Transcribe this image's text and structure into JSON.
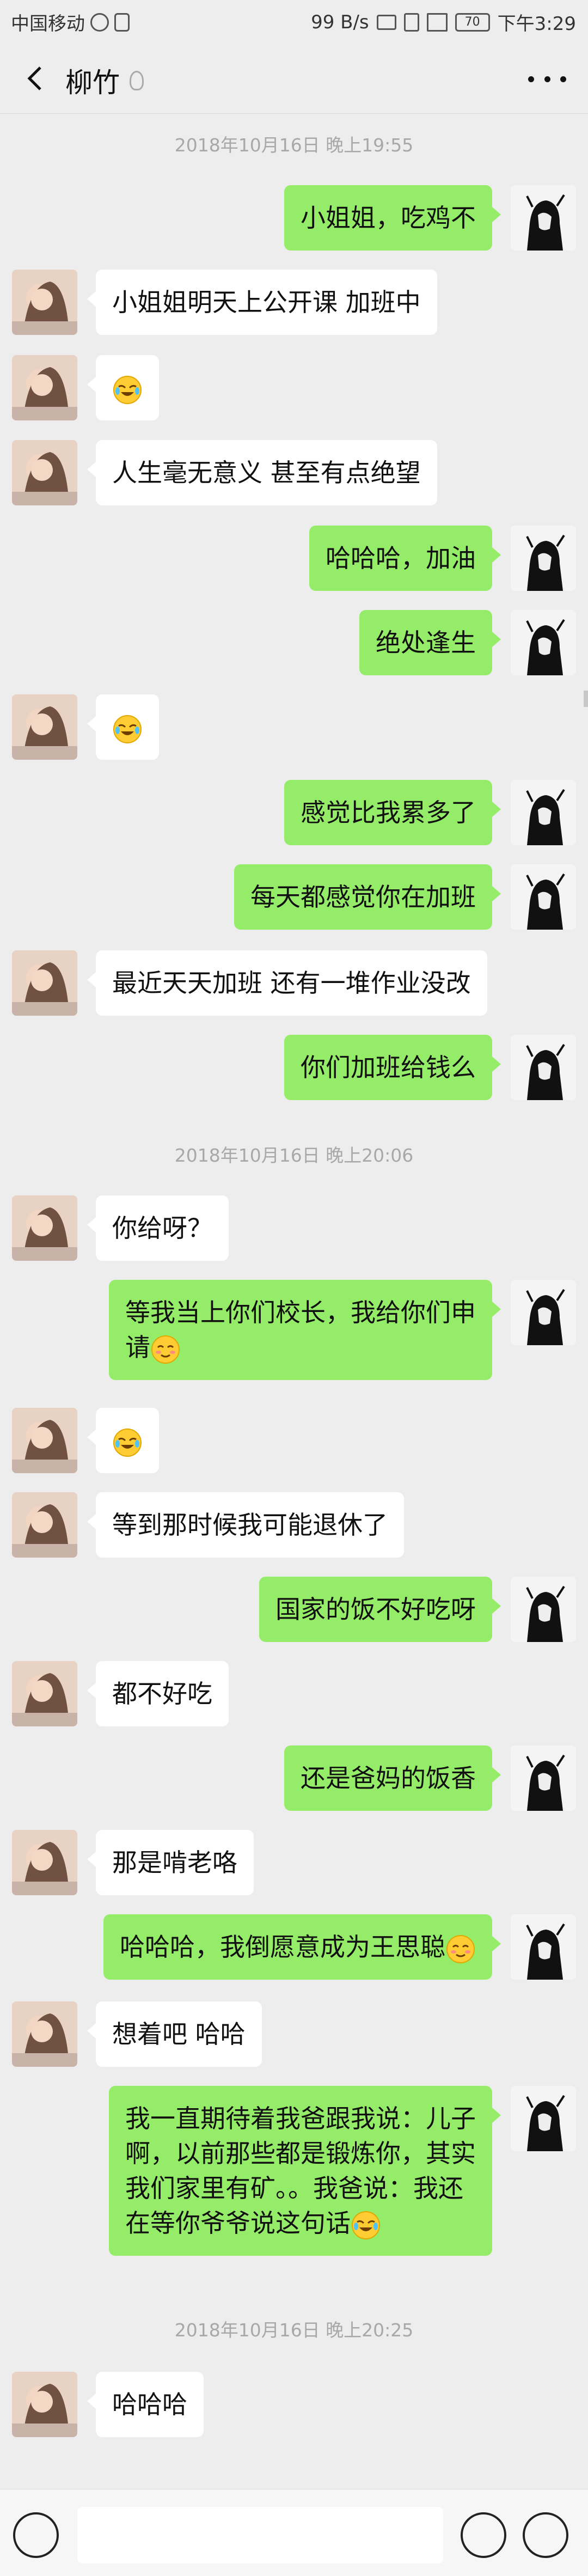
{
  "status": {
    "carrier": "中国移动",
    "speed": "99 B/s",
    "battery": "70",
    "time": "下午3:29"
  },
  "header": {
    "contact": "柳竹"
  },
  "timestamps": [
    "2018年10月16日 晚上19:55",
    "2018年10月16日 晚上20:06",
    "2018年10月16日 晚上20:25"
  ],
  "messages": [
    {
      "from": "me",
      "text": "小姐姐，吃鸡不"
    },
    {
      "from": "them",
      "text": "小姐姐明天上公开课  加班中"
    },
    {
      "from": "them",
      "emoji": "laugh-cry-emoji"
    },
    {
      "from": "them",
      "text": "人生毫无意义  甚至有点绝望"
    },
    {
      "from": "me",
      "text": "哈哈哈，加油"
    },
    {
      "from": "me",
      "text": "绝处逢生"
    },
    {
      "from": "them",
      "emoji": "laugh-cry-emoji"
    },
    {
      "from": "me",
      "text": "感觉比我累多了"
    },
    {
      "from": "me",
      "text": "每天都感觉你在加班"
    },
    {
      "from": "them",
      "text": "最近天天加班  还有一堆作业没改"
    },
    {
      "from": "me",
      "text": "你们加班给钱么"
    },
    {
      "from": "them",
      "text": "你给呀？"
    },
    {
      "from": "me",
      "lines": [
        "等我当上你们校长，我给你们申",
        "请"
      ],
      "emoji": "blush-emoji"
    },
    {
      "from": "them",
      "emoji": "laugh-cry-emoji"
    },
    {
      "from": "them",
      "text": "等到那时候我可能退休了"
    },
    {
      "from": "me",
      "text": "国家的饭不好吃呀"
    },
    {
      "from": "them",
      "text": "都不好吃"
    },
    {
      "from": "me",
      "text": "还是爸妈的饭香"
    },
    {
      "from": "them",
      "text": "那是啃老咯"
    },
    {
      "from": "me",
      "text": "哈哈哈，我倒愿意成为王思聪",
      "emoji": "blush-emoji"
    },
    {
      "from": "them",
      "text": "想着吧 哈哈"
    },
    {
      "from": "me",
      "lines": [
        "我一直期待着我爸跟我说：儿子",
        "啊，以前那些都是锻炼你，其实",
        "我们家里有矿。。我爸说：我还",
        "在等你爷爷说这句话"
      ],
      "emoji": "laugh-cry-emoji"
    },
    {
      "from": "them",
      "text": "哈哈哈"
    }
  ],
  "colors": {
    "bg": "#ededed",
    "me_bubble": "#95ec69",
    "them_bubble": "#ffffff",
    "timestamp": "#a8a8a8"
  },
  "icons": {
    "back": "back-arrow-icon",
    "more": "more-dots-icon",
    "voice": "voice-icon",
    "emoji": "emoji-icon",
    "plus": "plus-icon",
    "earpiece": "earpiece-icon"
  }
}
